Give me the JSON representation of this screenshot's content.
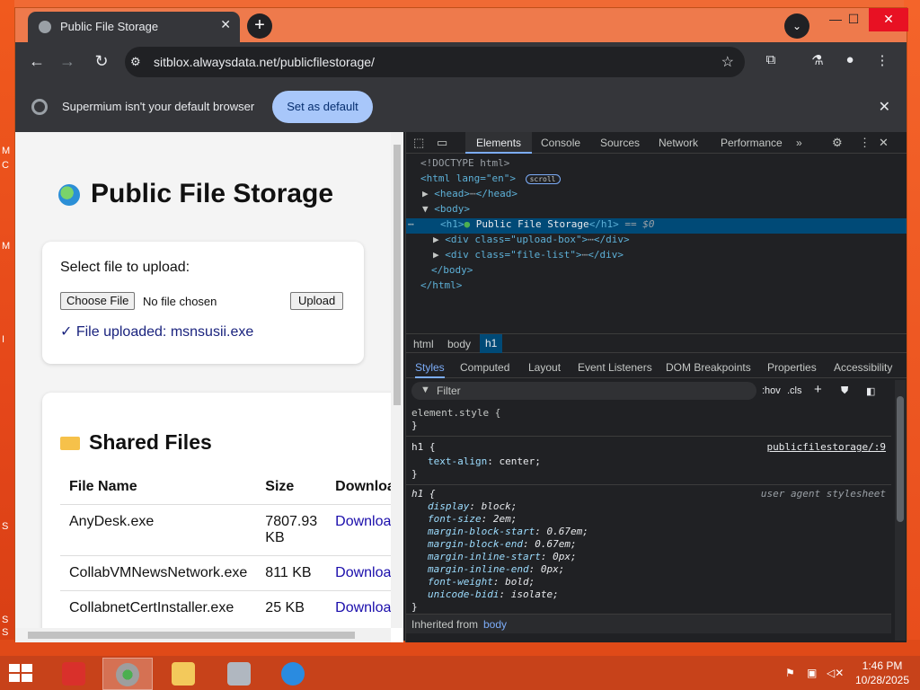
{
  "desktop": {
    "edge_labels": [
      "M",
      "C",
      "M",
      "I",
      "S",
      "S",
      "S"
    ]
  },
  "browser": {
    "tab_title": "Public File Storage",
    "tab_close": "✕",
    "new_tab": "+",
    "tab_search": "⌄",
    "window_controls": {
      "minimize": "—",
      "maximize": "☐",
      "close": "✕"
    },
    "nav": {
      "back": "←",
      "forward": "→",
      "reload": "↻"
    },
    "url": "sitblox.alwaysdata.net/publicfilestorage/",
    "infobar": {
      "message": "Supermium isn't your default browser",
      "button": "Set as default",
      "close": "✕"
    }
  },
  "page": {
    "title": "Public File Storage",
    "upload": {
      "label": "Select file to upload:",
      "choose_button": "Choose File",
      "no_file": "No file chosen",
      "upload_button": "Upload",
      "status": "✓ File uploaded: msnsusii.exe"
    },
    "files": {
      "heading": "Shared Files",
      "columns": [
        "File Name",
        "Size",
        "Downloa"
      ],
      "rows": [
        {
          "name": "AnyDesk.exe",
          "size": "7807.93 KB",
          "link": "Downloa"
        },
        {
          "name": "CollabVMNewsNetwork.exe",
          "size": "811 KB",
          "link": "Downloa"
        },
        {
          "name": "CollabnetCertInstaller.exe",
          "size": "25 KB",
          "link": "Downloa"
        }
      ]
    }
  },
  "devtools": {
    "tabs": [
      "Elements",
      "Console",
      "Sources",
      "Network",
      "Performance",
      "»"
    ],
    "dom": {
      "doctype": "<!DOCTYPE html>",
      "html_open": "<html lang=\"en\">",
      "scroll_badge": "scroll",
      "head": "<head>",
      "head_close": "</head>",
      "body_open": "<body>",
      "h1_line": "<h1>",
      "h1_text": " Public File Storage",
      "h1_close": "</h1>",
      "h1_marker": "== $0",
      "div_upload": "<div class=\"upload-box\">",
      "div_files": "<div class=\"file-list\">",
      "div_close": "</div>",
      "body_close": "</body>",
      "html_close": "</html>"
    },
    "breadcrumbs": [
      "html",
      "body",
      "h1"
    ],
    "subtabs": [
      "Styles",
      "Computed",
      "Layout",
      "Event Listeners",
      "DOM Breakpoints",
      "Properties",
      "Accessibility"
    ],
    "filter_placeholder": "Filter",
    "filter_buttons": [
      ":hov",
      ".cls",
      "+"
    ],
    "styles": {
      "element_style": "element.style {",
      "close_brace": "}",
      "rule1_selector": "h1 {",
      "rule1_source": "publicfilestorage/:9",
      "rule1_props": [
        {
          "name": "text-align",
          "value": "center;"
        }
      ],
      "ua_selector": "h1 {",
      "ua_source": "user agent stylesheet",
      "ua_props": [
        {
          "name": "display",
          "value": "block;"
        },
        {
          "name": "font-size",
          "value": "2em;"
        },
        {
          "name": "margin-block-start",
          "value": "0.67em;"
        },
        {
          "name": "margin-block-end",
          "value": "0.67em;"
        },
        {
          "name": "margin-inline-start",
          "value": "0px;"
        },
        {
          "name": "margin-inline-end",
          "value": "0px;"
        },
        {
          "name": "font-weight",
          "value": "bold;"
        },
        {
          "name": "unicode-bidi",
          "value": "isolate;"
        }
      ],
      "inherited_label": "Inherited from",
      "inherited_from": "body"
    }
  },
  "taskbar": {
    "time": "1:46 PM",
    "date": "10/28/2025",
    "tray_icons": [
      "flag-icon",
      "network-icon",
      "volume-muted-icon"
    ]
  }
}
